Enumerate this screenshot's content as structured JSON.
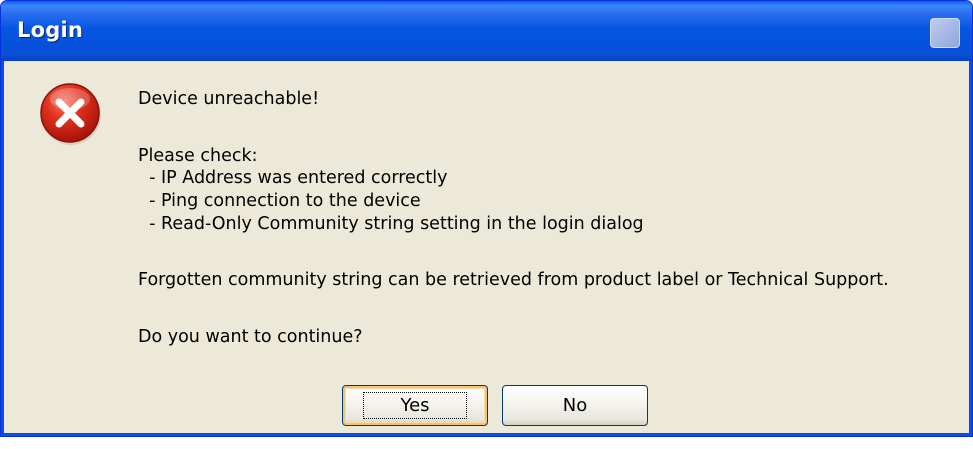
{
  "dialog": {
    "title": "Login",
    "icon": "error-icon",
    "message": {
      "line1": "Device unreachable!",
      "line2": "Please check:",
      "line3": "  - IP Address was entered correctly",
      "line4": "  - Ping connection to the device",
      "line5": "  - Read-Only Community string setting in the login dialog",
      "line6": "Forgotten community string can be retrieved from product label or Technical Support.",
      "line7": "Do you want to continue?"
    },
    "buttons": {
      "yes": "Yes",
      "no": "No"
    }
  },
  "colors": {
    "titlebar": "#0552dc",
    "face": "#ece9d8",
    "error_red": "#d4200f",
    "focus_orange": "#f3c37d"
  }
}
